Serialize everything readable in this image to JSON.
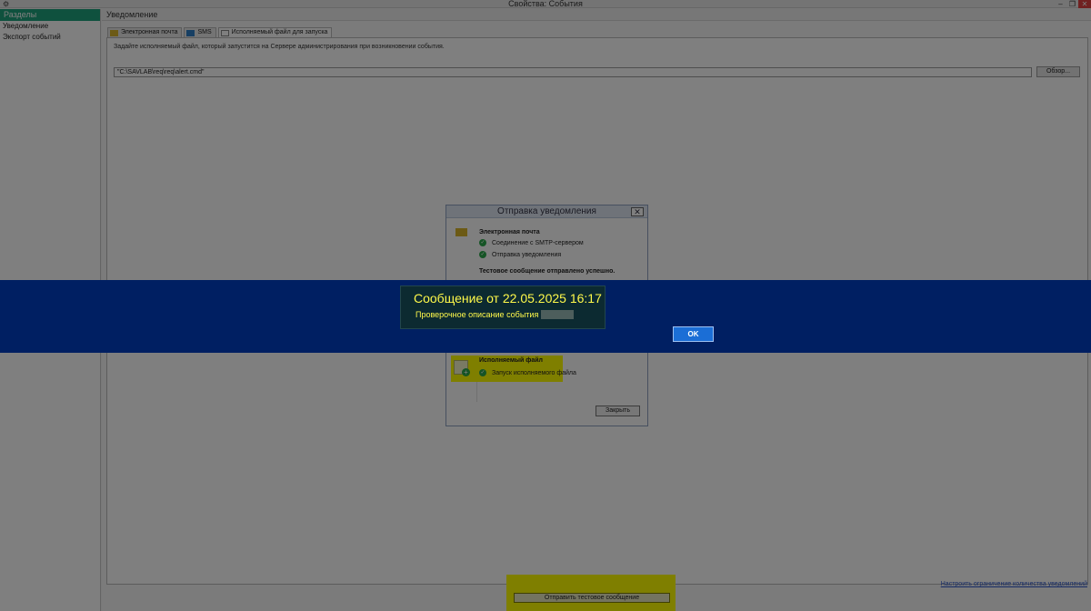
{
  "window": {
    "title": "Свойства: События",
    "sys_icon": "⚙",
    "minimize": "–",
    "maximize": "❐",
    "close": "✕"
  },
  "sidebar": {
    "header": "Разделы",
    "items": [
      {
        "label": "Уведомление"
      },
      {
        "label": "Экспорт событий"
      }
    ]
  },
  "main": {
    "header": "Уведомление",
    "tabs": [
      {
        "label": "Электронная почта",
        "icon": "mail-icon"
      },
      {
        "label": "SMS",
        "icon": "sms-icon"
      },
      {
        "label": "Исполняемый файл для запуска",
        "icon": "exe-icon"
      }
    ],
    "description": "Задайте исполняемый файл, который запустится на Сервере администрирования при возникновении события.",
    "path_value": "\"C:\\SAVLAB\\req\\req\\alert.cmd\"",
    "browse_label": "Обзор...",
    "limit_link": "Настроить ограничение количества уведомлений",
    "send_test_label": "Отправить тестовое сообщение"
  },
  "dialog": {
    "title": "Отправка уведомления",
    "close": "✕",
    "email_section": "Электронная почта",
    "email_checks": [
      {
        "label": "Соединение с SMTP-сервером"
      },
      {
        "label": "Отправка уведомления"
      }
    ],
    "success": "Тестовое сообщение отправлено успешно.",
    "file_section": "Исполняемый файл",
    "file_checks": [
      {
        "label": "Запуск исполняемого файла"
      }
    ],
    "close_button": "Закрыть"
  },
  "message": {
    "title": "Сообщение от  22.05.2025 16:17",
    "description": "Проверочное описание события",
    "ok_label": "OK"
  },
  "colors": {
    "sidebar_header": "#1fa27c",
    "banner": "#001f62",
    "message_text": "#fff94a",
    "highlight": "#ffff00",
    "ok_button": "#1b6ed6"
  }
}
